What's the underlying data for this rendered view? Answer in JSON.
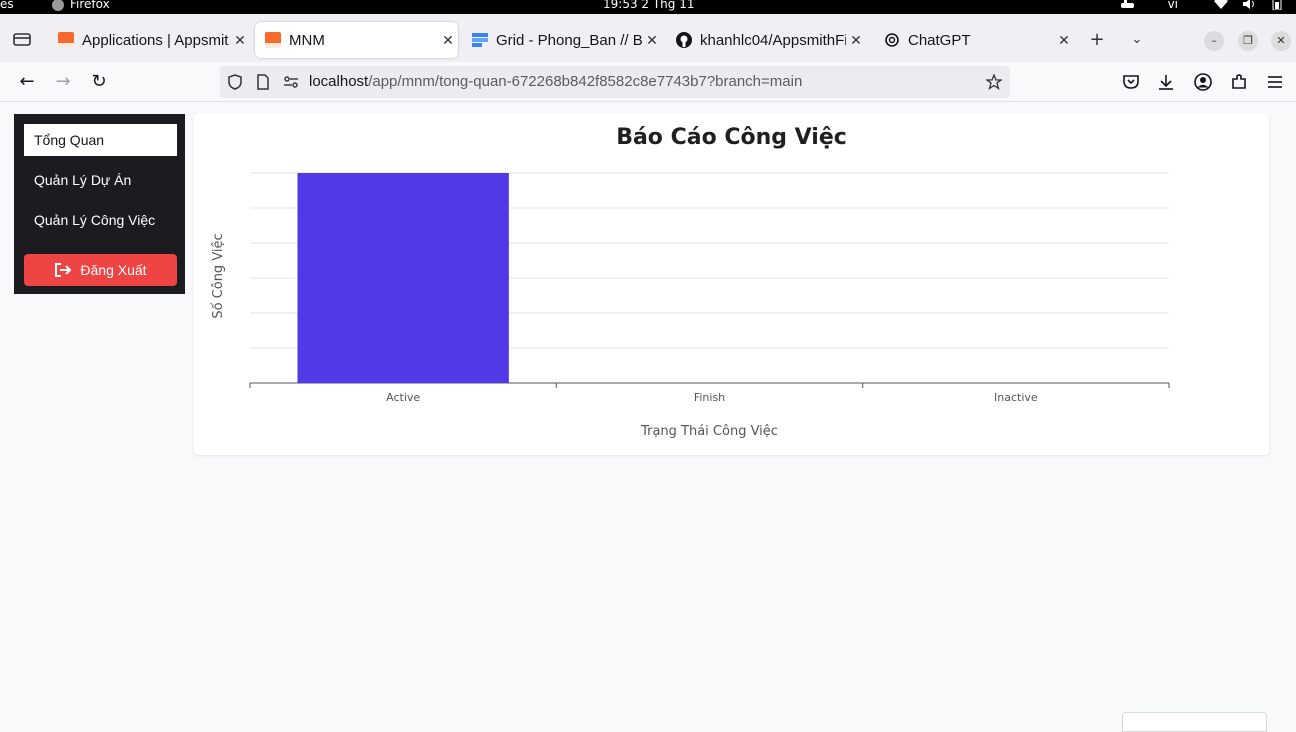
{
  "os": {
    "activities": "es",
    "app_name": "Firefox",
    "clock": "19:53  2 Thg 11",
    "lang": "vi"
  },
  "tabs": [
    {
      "title": "Applications | Appsmit",
      "favicon": "appsmith-icon",
      "active": false
    },
    {
      "title": "MNM",
      "favicon": "appsmith-icon",
      "active": true
    },
    {
      "title": "Grid - Phong_Ban // Ba",
      "favicon": "grid-icon",
      "active": false
    },
    {
      "title": "khanhlc04/AppsmithFi",
      "favicon": "github-icon",
      "active": false
    },
    {
      "title": "ChatGPT",
      "favicon": "chatgpt-icon",
      "active": false
    }
  ],
  "url": {
    "host": "localhost",
    "path": "/app/mnm/tong-quan-672268b842f8582c8e7743b7?branch=main"
  },
  "sidebar": {
    "items": [
      {
        "label": "Tổng Quan",
        "active": true
      },
      {
        "label": "Quản Lý Dự Án",
        "active": false
      },
      {
        "label": "Quản Lý Công Việc",
        "active": false
      }
    ],
    "logout_label": "Đăng Xuất"
  },
  "colors": {
    "bar": "#5239e8",
    "logout": "#ef4444",
    "sidebar_bg": "#1c1b1f"
  },
  "chart_data": {
    "type": "bar",
    "title": "Báo Cáo Công Việc",
    "xlabel": "Trạng Thái Công Việc",
    "ylabel": "Số Công Việc",
    "categories": [
      "Active",
      "Finish",
      "Inactive"
    ],
    "values": [
      6,
      0,
      0
    ],
    "ylim": [
      0,
      6
    ],
    "grid": true
  }
}
